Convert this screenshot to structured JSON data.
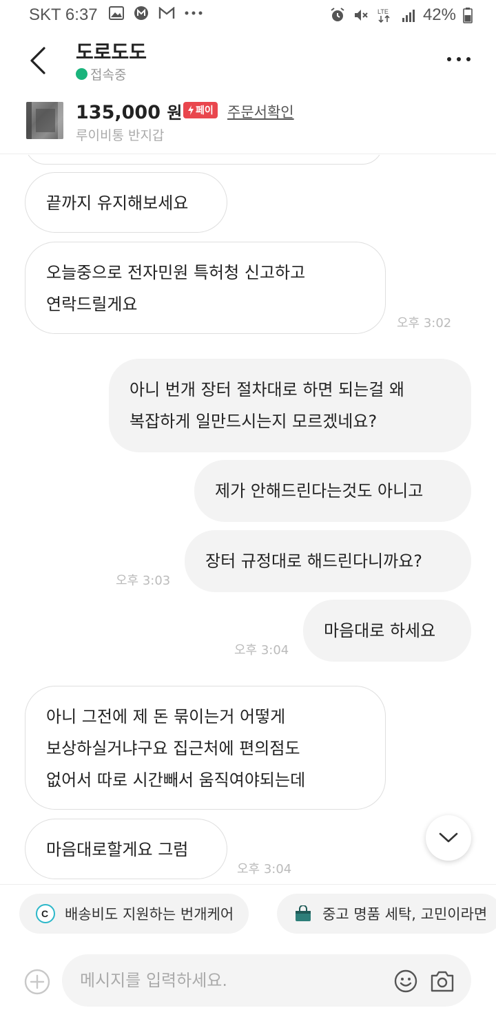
{
  "status_bar": {
    "carrier": "SKT",
    "time": "6:37",
    "network": "LTE",
    "battery": "42%"
  },
  "header": {
    "title": "도로도도",
    "status": "접속중"
  },
  "product": {
    "price": "135,000",
    "currency": "원",
    "pay_badge": "페이",
    "order_link": "주문서확인",
    "name": "루이비통 반지갑"
  },
  "messages": [
    {
      "side": "recv",
      "lines": [
        "끝까지 유지해보세요"
      ]
    },
    {
      "side": "recv",
      "lines": [
        "오늘중으로 전자민원 특허청 신고하고",
        "연락드릴게요"
      ],
      "time": "오후 3:02"
    },
    {
      "side": "sent",
      "lines": [
        "아니 번개 장터 절차대로 하면 되는걸 왜",
        "복잡하게 일만드시는지 모르겠네요?"
      ]
    },
    {
      "side": "sent",
      "lines": [
        "제가 안해드린다는것도 아니고"
      ]
    },
    {
      "side": "sent",
      "lines": [
        "장터 규정대로 해드린다니까요?"
      ],
      "time": "오후 3:03"
    },
    {
      "side": "sent",
      "lines": [
        "마음대로 하세요"
      ],
      "time": "오후 3:04"
    },
    {
      "side": "recv",
      "lines": [
        "아니 그전에 제 돈 묶이는거 어떻게",
        "보상하실거냐구요 집근처에 편의점도",
        "없어서 따로 시간빼서 움직여야되는데"
      ]
    },
    {
      "side": "recv",
      "lines": [
        "마음대로할게요 그럼"
      ],
      "time": "오후 3:04"
    }
  ],
  "chips": [
    {
      "label": "배송비도 지원하는 번개케어",
      "icon": "bungae-care-icon"
    },
    {
      "label": "중고 명품 세탁, 고민이라면",
      "icon": "shopping-bag-icon"
    }
  ],
  "input": {
    "placeholder": "메시지를 입력하세요."
  },
  "colors": {
    "online": "#1ab47c",
    "pay_badge": "#e9464d",
    "sent_bubble": "#f3f3f3",
    "recv_border": "#dedede"
  }
}
